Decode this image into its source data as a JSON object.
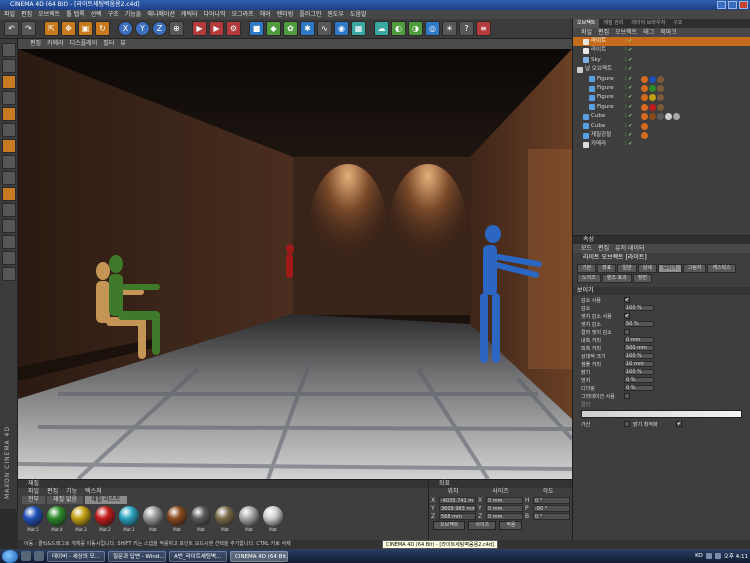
{
  "window": {
    "title": "CINEMA 4D (64 Bit) - [라이트세팅벽움용2.c4d]"
  },
  "menubar": [
    "파일",
    "편집",
    "오브젝트",
    "툴 탭록",
    "선택",
    "구조",
    "기능들",
    "애니메이션",
    "캐릭터",
    "다이나믹",
    "모그라프",
    "헤어",
    "렌더링",
    "플러그인",
    "윈도우",
    "도움말"
  ],
  "viewport": {
    "menu": [
      "편집",
      "카메라",
      "디스플레이",
      "필터",
      "뷰"
    ]
  },
  "material_manager": {
    "title": "재질",
    "menu": [
      "파일",
      "편집",
      "기능",
      "텍스쳐"
    ],
    "tabs": [
      "전부",
      "재질 없음",
      "재질 리스트"
    ],
    "active_tab": 2,
    "materials": [
      {
        "name": "Mat.5",
        "color": "#1f4fb8"
      },
      {
        "name": "Mat.4",
        "color": "#2c8a2a"
      },
      {
        "name": "Mat.3",
        "color": "#c2a012"
      },
      {
        "name": "Mat.2",
        "color": "#c21a1a"
      },
      {
        "name": "Mat.1",
        "color": "#2aa3c0"
      },
      {
        "name": "Mat",
        "color": "#9a9a9a"
      },
      {
        "name": "Mat",
        "color": "#8a4a1e"
      },
      {
        "name": "Mat",
        "color": "#5a5a5a"
      },
      {
        "name": "Mat",
        "color": "#7a6a4a"
      },
      {
        "name": "Mat",
        "color": "#a8a8a8"
      },
      {
        "name": "Mat",
        "color": "#cfcfcf"
      }
    ]
  },
  "coordinates": {
    "title": "좌표",
    "headers": [
      "위치",
      "사이즈",
      "각도"
    ],
    "rows": [
      {
        "axis": "X",
        "pos": "-4035.741 m",
        "size": "0 mm",
        "rlabel": "H",
        "rot": "0 °"
      },
      {
        "axis": "Y",
        "pos": "3609.983 mm",
        "size": "0 mm",
        "rlabel": "P",
        "rot": "-90 °"
      },
      {
        "axis": "Z",
        "pos": "568 mm",
        "size": "0 mm",
        "rlabel": "B",
        "rot": "0 °"
      }
    ],
    "mode_left": "오브젝트",
    "mode_right": "사이즈",
    "apply": "적용"
  },
  "object_manager": {
    "tabs": [
      "오브젝트",
      "재질 관리",
      "레이어 브라우저",
      "구조"
    ],
    "menu": [
      "파일",
      "편집",
      "오브젝트",
      "태그",
      "북마크"
    ],
    "objects": [
      {
        "name": "라이트",
        "indent": 1,
        "color": "#e8e8e8",
        "selected": true,
        "tags": []
      },
      {
        "name": "라이트",
        "indent": 1,
        "color": "#e8e8e8",
        "selected": false,
        "tags": []
      },
      {
        "name": "Sky",
        "indent": 1,
        "color": "#7fb0e8",
        "selected": false,
        "tags": []
      },
      {
        "name": "널 오브젝트",
        "indent": 0,
        "color": "#cccccc",
        "selected": false,
        "tags": []
      },
      {
        "name": "Figure",
        "indent": 2,
        "color": "#58a0e0",
        "selected": false,
        "tags": [
          "#d46a1c",
          "#1f4fb8",
          "#7a5a3a"
        ]
      },
      {
        "name": "Figure",
        "indent": 2,
        "color": "#58a0e0",
        "selected": false,
        "tags": [
          "#d46a1c",
          "#2c8a2a",
          "#7a5a3a"
        ]
      },
      {
        "name": "Figure",
        "indent": 2,
        "color": "#58a0e0",
        "selected": false,
        "tags": [
          "#d46a1c",
          "#c2a012",
          "#7a5a3a"
        ]
      },
      {
        "name": "Figure",
        "indent": 2,
        "color": "#58a0e0",
        "selected": false,
        "tags": [
          "#d46a1c",
          "#c21a1a",
          "#7a5a3a"
        ]
      },
      {
        "name": "Cube",
        "indent": 1,
        "color": "#58a0e0",
        "selected": false,
        "tags": [
          "#d46a1c",
          "#8a4a1e",
          "#5a5a5a",
          "#cfcfcf",
          "#a8a8a8"
        ]
      },
      {
        "name": "Cube",
        "indent": 1,
        "color": "#58a0e0",
        "selected": false,
        "tags": [
          "#d46a1c"
        ]
      },
      {
        "name": "재질강철",
        "indent": 1,
        "color": "#58a0e0",
        "selected": false,
        "tags": [
          "#d46a1c"
        ]
      },
      {
        "name": "카메라",
        "indent": 1,
        "color": "#dddddd",
        "selected": false,
        "tags": []
      }
    ]
  },
  "attributes": {
    "title": "속성",
    "menu": [
      "모드",
      "편집",
      "유저 데이터"
    ],
    "object_name": "라이트 오브젝트 [라이트]",
    "tabs": [
      "기본",
      "좌표",
      "일반",
      "상세",
      "보이기",
      "그림자",
      "캐스틱스",
      "노이즈",
      "렌즈 효과",
      "장면"
    ],
    "active_tab": 4,
    "section": "보이기",
    "rows": [
      {
        "label": "감소 사용",
        "value": "",
        "check": "✔"
      },
      {
        "label": "감소",
        "value": "100 %",
        "check": ""
      },
      {
        "label": "엣지 감소 사용",
        "value": "",
        "check": "✔"
      },
      {
        "label": "엣지 감소",
        "value": "50 %",
        "check": ""
      },
      {
        "label": "컬러 엣지 감소",
        "value": "",
        "check": " "
      },
      {
        "label": "내측 거리",
        "value": "0 mm",
        "check": ""
      },
      {
        "label": "외측 거리",
        "value": "500 mm",
        "check": ""
      },
      {
        "label": "상대적 크기",
        "value": "100 %",
        "check": ""
      },
      {
        "label": "샘플 거리",
        "value": "10 mm",
        "check": ""
      },
      {
        "label": "밝기",
        "value": "100 %",
        "check": ""
      },
      {
        "label": "먼지",
        "value": "0 %",
        "check": ""
      },
      {
        "label": "디더링",
        "value": "0 %",
        "check": ""
      }
    ],
    "gradient_label": "그라데이션 사용",
    "color_label": "컬러",
    "footer_label": "가산",
    "footer_label2": "밝기 최적화"
  },
  "status": {
    "text": "이동 : 클릭&드래그로 개체를 이동시킵니다. SHIFT 키는 스냅을 적용하고 포인트 모드시엔 선택을 추가합니다. CTRL 키로 삭제"
  },
  "tooltip": {
    "text": "CINEMA 4D (64 Bit) - [라이트세팅벽움용2.c4d]"
  },
  "taskbar": {
    "tasks": [
      "데이버 - 세상의 모...",
      "질문과 답변 - Wind...",
      "A번_라이트세팅벽...",
      "CINEMA 4D (64 Bit..."
    ],
    "active_task": 3,
    "lang": "KO",
    "time": "오후 4:11"
  }
}
